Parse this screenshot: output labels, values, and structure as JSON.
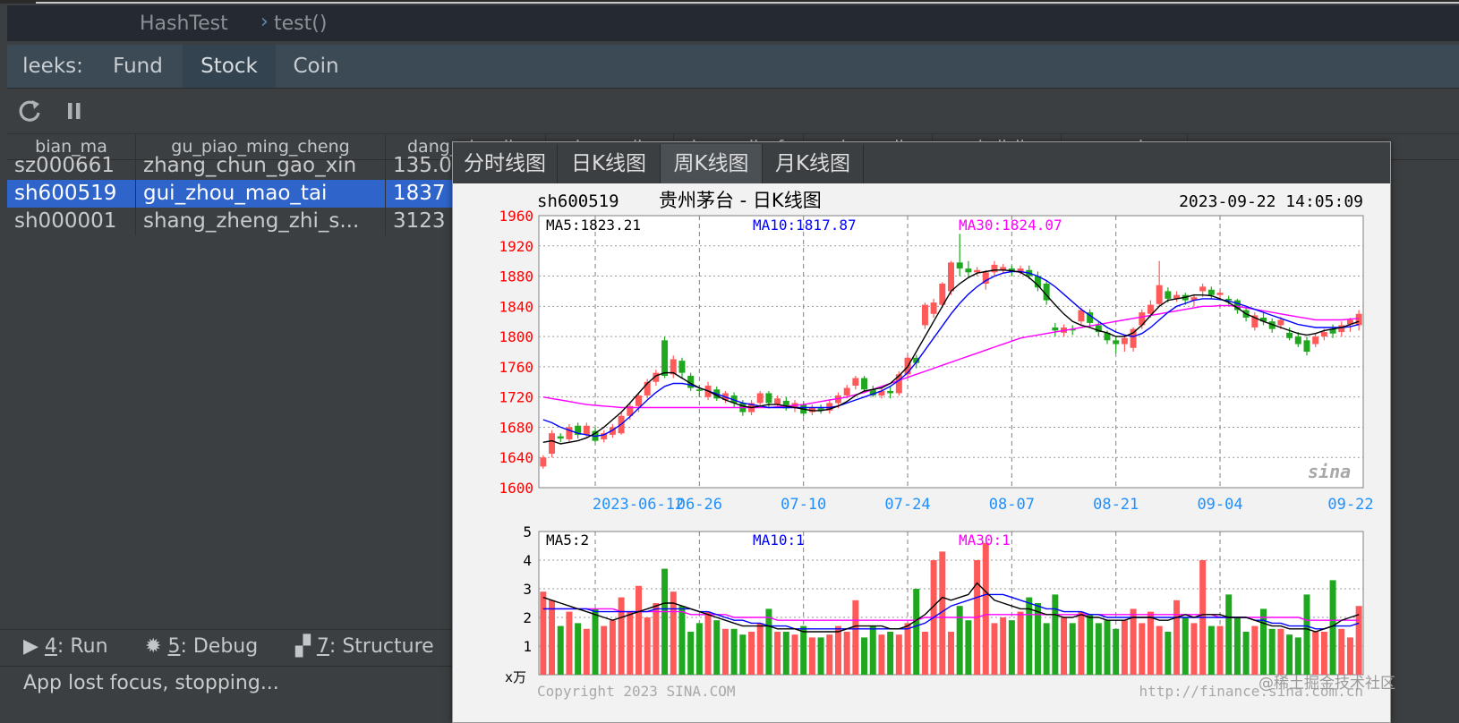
{
  "breadcrumb": {
    "class_name": "HashTest",
    "method_name": "test()"
  },
  "tabs": {
    "prefix": "leeks:",
    "items": [
      "Fund",
      "Stock",
      "Coin"
    ],
    "active": "Stock"
  },
  "toolbar": {
    "refresh_icon": "refresh-icon",
    "pause_icon": "pause-icon"
  },
  "table": {
    "columns": [
      "bian_ma",
      "gu_piao_ming_cheng",
      "dang_qian_jia",
      "zhang_die",
      "zhang_die_fu",
      "zui_gao_jia",
      "zui_di_jia",
      "geng_xin_s"
    ],
    "rows": [
      {
        "code": "sz000661",
        "name": "zhang_chun_gao_xin",
        "price": "135.0"
      },
      {
        "code": "sh600519",
        "name": "gui_zhou_mao_tai",
        "price": "1837"
      },
      {
        "code": "sh000001",
        "name": "shang_zheng_zhi_s...",
        "price": "3123"
      }
    ],
    "selected_row": 1
  },
  "popup": {
    "tabs": [
      "分时线图",
      "日K线图",
      "周K线图",
      "月K线图"
    ],
    "active_tab": "日K线图"
  },
  "chart_header": {
    "symbol": "sh600519",
    "title": "贵州茅台 - 日K线图",
    "timestamp": "2023-09-22 14:05:09"
  },
  "chart_data": [
    {
      "type": "candlestick",
      "ylim": [
        1600,
        1960
      ],
      "yticks": [
        1600,
        1640,
        1680,
        1720,
        1760,
        1800,
        1840,
        1880,
        1920,
        1960
      ],
      "xticks": [
        "2023-06-12",
        "06-26",
        "07-10",
        "07-24",
        "08-07",
        "08-21",
        "09-04",
        "09-22"
      ],
      "legend": {
        "ma5": "MA5:1823.21",
        "ma10": "MA10:1817.87",
        "ma30": "MA30:1824.07"
      },
      "colors": {
        "up": "#ff5a5a",
        "down": "#1fa81f",
        "ma5": "#000000",
        "ma10": "#0000ff",
        "ma30": "#ff00ff",
        "axis_text": "#ff0000",
        "date_text": "#1e90ff"
      },
      "candles": [
        [
          1628,
          1640,
          1625,
          1643
        ],
        [
          1645,
          1672,
          1640,
          1676
        ],
        [
          1668,
          1665,
          1660,
          1672
        ],
        [
          1664,
          1680,
          1660,
          1684
        ],
        [
          1682,
          1670,
          1665,
          1686
        ],
        [
          1670,
          1682,
          1668,
          1686
        ],
        [
          1675,
          1662,
          1660,
          1680
        ],
        [
          1664,
          1672,
          1660,
          1676
        ],
        [
          1670,
          1680,
          1666,
          1684
        ],
        [
          1672,
          1695,
          1670,
          1700
        ],
        [
          1695,
          1708,
          1690,
          1712
        ],
        [
          1708,
          1722,
          1700,
          1726
        ],
        [
          1722,
          1740,
          1718,
          1744
        ],
        [
          1740,
          1752,
          1735,
          1756
        ],
        [
          1795,
          1748,
          1745,
          1800
        ],
        [
          1750,
          1770,
          1745,
          1775
        ],
        [
          1768,
          1752,
          1745,
          1772
        ],
        [
          1748,
          1732,
          1728,
          1752
        ],
        [
          1730,
          1728,
          1720,
          1736
        ],
        [
          1720,
          1735,
          1716,
          1740
        ],
        [
          1730,
          1718,
          1715,
          1734
        ],
        [
          1716,
          1725,
          1712,
          1728
        ],
        [
          1722,
          1712,
          1706,
          1726
        ],
        [
          1712,
          1700,
          1695,
          1716
        ],
        [
          1700,
          1712,
          1696,
          1716
        ],
        [
          1712,
          1725,
          1708,
          1728
        ],
        [
          1725,
          1712,
          1705,
          1728
        ],
        [
          1710,
          1718,
          1706,
          1722
        ],
        [
          1715,
          1705,
          1702,
          1720
        ],
        [
          1706,
          1712,
          1700,
          1716
        ],
        [
          1710,
          1698,
          1694,
          1714
        ],
        [
          1700,
          1706,
          1696,
          1710
        ],
        [
          1705,
          1702,
          1698,
          1710
        ],
        [
          1702,
          1712,
          1698,
          1716
        ],
        [
          1712,
          1722,
          1705,
          1726
        ],
        [
          1722,
          1732,
          1718,
          1736
        ],
        [
          1735,
          1745,
          1730,
          1748
        ],
        [
          1745,
          1730,
          1725,
          1748
        ],
        [
          1730,
          1722,
          1720,
          1735
        ],
        [
          1722,
          1728,
          1718,
          1732
        ],
        [
          1728,
          1725,
          1718,
          1734
        ],
        [
          1725,
          1750,
          1722,
          1754
        ],
        [
          1750,
          1772,
          1745,
          1775
        ],
        [
          1772,
          1765,
          1758,
          1776
        ],
        [
          1815,
          1842,
          1810,
          1845
        ],
        [
          1830,
          1845,
          1825,
          1850
        ],
        [
          1842,
          1870,
          1838,
          1872
        ],
        [
          1860,
          1898,
          1855,
          1900
        ],
        [
          1898,
          1890,
          1880,
          1936
        ],
        [
          1890,
          1885,
          1878,
          1900
        ],
        [
          1885,
          1888,
          1880,
          1892
        ],
        [
          1870,
          1885,
          1862,
          1888
        ],
        [
          1885,
          1895,
          1880,
          1900
        ],
        [
          1888,
          1892,
          1884,
          1896
        ],
        [
          1890,
          1886,
          1880,
          1894
        ],
        [
          1886,
          1890,
          1882,
          1894
        ],
        [
          1888,
          1880,
          1876,
          1894
        ],
        [
          1880,
          1865,
          1860,
          1886
        ],
        [
          1870,
          1848,
          1842,
          1874
        ],
        [
          1812,
          1808,
          1800,
          1818
        ],
        [
          1805,
          1812,
          1800,
          1816
        ],
        [
          1810,
          1808,
          1802,
          1815
        ],
        [
          1820,
          1835,
          1815,
          1838
        ],
        [
          1832,
          1818,
          1812,
          1836
        ],
        [
          1815,
          1806,
          1800,
          1820
        ],
        [
          1805,
          1795,
          1790,
          1808
        ],
        [
          1795,
          1790,
          1778,
          1800
        ],
        [
          1790,
          1798,
          1780,
          1802
        ],
        [
          1785,
          1810,
          1780,
          1812
        ],
        [
          1815,
          1832,
          1810,
          1836
        ],
        [
          1830,
          1842,
          1825,
          1848
        ],
        [
          1843,
          1868,
          1840,
          1900
        ],
        [
          1860,
          1850,
          1845,
          1865
        ],
        [
          1850,
          1855,
          1846,
          1860
        ],
        [
          1855,
          1848,
          1842,
          1858
        ],
        [
          1848,
          1852,
          1840,
          1856
        ],
        [
          1860,
          1866,
          1852,
          1870
        ],
        [
          1862,
          1855,
          1850,
          1866
        ],
        [
          1855,
          1858,
          1850,
          1862
        ],
        [
          1850,
          1848,
          1842,
          1854
        ],
        [
          1848,
          1835,
          1830,
          1850
        ],
        [
          1835,
          1825,
          1820,
          1840
        ],
        [
          1812,
          1828,
          1808,
          1832
        ],
        [
          1825,
          1820,
          1815,
          1832
        ],
        [
          1820,
          1810,
          1805,
          1824
        ],
        [
          1815,
          1822,
          1810,
          1826
        ],
        [
          1805,
          1798,
          1795,
          1812
        ],
        [
          1800,
          1790,
          1786,
          1806
        ],
        [
          1795,
          1780,
          1775,
          1800
        ],
        [
          1790,
          1800,
          1786,
          1804
        ],
        [
          1800,
          1806,
          1795,
          1810
        ],
        [
          1810,
          1804,
          1798,
          1816
        ],
        [
          1806,
          1815,
          1800,
          1820
        ],
        [
          1816,
          1822,
          1806,
          1825
        ],
        [
          1815,
          1830,
          1808,
          1835
        ]
      ],
      "ma5": [
        1660,
        1662,
        1658,
        1660,
        1662,
        1666,
        1672,
        1680,
        1690,
        1700,
        1712,
        1725,
        1738,
        1748,
        1752,
        1752,
        1745,
        1738,
        1732,
        1728,
        1722,
        1716,
        1712,
        1708,
        1706,
        1708,
        1710,
        1710,
        1708,
        1706,
        1704,
        1702,
        1702,
        1704,
        1708,
        1714,
        1722,
        1728,
        1730,
        1732,
        1738,
        1748,
        1760,
        1780,
        1800,
        1820,
        1840,
        1860,
        1870,
        1878,
        1884,
        1886,
        1888,
        1888,
        1887,
        1885,
        1878,
        1868,
        1855,
        1842,
        1830,
        1820,
        1815,
        1812,
        1808,
        1805,
        1800,
        1800,
        1805,
        1815,
        1828,
        1840,
        1848,
        1850,
        1852,
        1855,
        1855,
        1854,
        1850,
        1845,
        1838,
        1830,
        1825,
        1820,
        1816,
        1812,
        1808,
        1804,
        1802,
        1804,
        1808,
        1810,
        1812,
        1816,
        1820
      ],
      "ma10": [
        1690,
        1686,
        1680,
        1676,
        1672,
        1670,
        1668,
        1670,
        1676,
        1684,
        1694,
        1705,
        1716,
        1726,
        1734,
        1738,
        1738,
        1736,
        1732,
        1728,
        1724,
        1720,
        1716,
        1712,
        1710,
        1708,
        1706,
        1706,
        1706,
        1706,
        1706,
        1706,
        1706,
        1706,
        1708,
        1712,
        1716,
        1720,
        1724,
        1728,
        1734,
        1742,
        1752,
        1766,
        1782,
        1798,
        1814,
        1830,
        1844,
        1856,
        1866,
        1874,
        1880,
        1884,
        1886,
        1886,
        1884,
        1880,
        1874,
        1866,
        1856,
        1846,
        1836,
        1828,
        1820,
        1812,
        1806,
        1802,
        1800,
        1804,
        1812,
        1822,
        1832,
        1840,
        1844,
        1848,
        1850,
        1850,
        1849,
        1847,
        1844,
        1840,
        1836,
        1832,
        1828,
        1824,
        1820,
        1816,
        1814,
        1812,
        1812,
        1812,
        1812,
        1813,
        1816
      ],
      "ma30": [
        1720,
        1718,
        1716,
        1714,
        1712,
        1710,
        1709,
        1708,
        1707,
        1706,
        1706,
        1706,
        1706,
        1706,
        1706,
        1706,
        1706,
        1706,
        1706,
        1706,
        1706,
        1706,
        1706,
        1706,
        1706,
        1706,
        1706,
        1707,
        1708,
        1709,
        1710,
        1712,
        1714,
        1716,
        1718,
        1720,
        1723,
        1726,
        1730,
        1734,
        1738,
        1742,
        1746,
        1750,
        1754,
        1758,
        1762,
        1766,
        1770,
        1774,
        1778,
        1782,
        1786,
        1790,
        1794,
        1798,
        1800,
        1802,
        1804,
        1806,
        1808,
        1810,
        1812,
        1814,
        1816,
        1818,
        1820,
        1822,
        1824,
        1826,
        1828,
        1830,
        1832,
        1834,
        1836,
        1838,
        1840,
        1840,
        1841,
        1841,
        1840,
        1838,
        1836,
        1834,
        1832,
        1830,
        1828,
        1826,
        1824,
        1822,
        1822,
        1822,
        1822,
        1823,
        1824
      ]
    },
    {
      "type": "bar",
      "ylim": [
        0,
        5
      ],
      "yticks": [
        1,
        2,
        3,
        4,
        5
      ],
      "unit_label": "x万",
      "legend": {
        "ma5": "MA5:2",
        "ma10": "MA10:1",
        "ma30": "MA30:1"
      },
      "volumes": [
        2.9,
        2.6,
        1.7,
        2.2,
        1.8,
        1.6,
        2.3,
        1.7,
        1.9,
        2.7,
        2.2,
        3.1,
        2.0,
        2.5,
        3.7,
        2.9,
        2.4,
        1.5,
        1.8,
        2.2,
        1.9,
        1.6,
        1.6,
        1.4,
        1.5,
        1.8,
        2.3,
        1.5,
        1.5,
        1.4,
        1.7,
        1.3,
        1.3,
        1.4,
        1.7,
        1.5,
        2.6,
        1.3,
        1.7,
        1.4,
        1.5,
        1.4,
        1.8,
        3.0,
        1.5,
        4.0,
        4.3,
        1.5,
        2.4,
        1.9,
        4.0,
        4.6,
        1.8,
        2.0,
        1.9,
        2.2,
        2.7,
        2.5,
        1.8,
        2.8,
        2.0,
        1.8,
        2.2,
        2.1,
        1.8,
        1.9,
        1.6,
        1.9,
        2.3,
        1.8,
        2.2,
        1.7,
        1.5,
        2.6,
        2.0,
        1.8,
        4.0,
        1.7,
        1.7,
        2.8,
        2.0,
        1.5,
        1.7,
        2.3,
        1.6,
        1.6,
        1.4,
        1.3,
        2.8,
        1.5,
        1.5,
        3.3,
        1.6,
        1.3,
        2.4
      ],
      "vol_ma5": [
        2.7,
        2.6,
        2.5,
        2.4,
        2.3,
        2.2,
        2.1,
        2.0,
        1.9,
        2.0,
        2.1,
        2.2,
        2.3,
        2.4,
        2.5,
        2.5,
        2.4,
        2.3,
        2.2,
        2.1,
        2.0,
        1.9,
        1.8,
        1.7,
        1.7,
        1.7,
        1.7,
        1.6,
        1.6,
        1.6,
        1.5,
        1.5,
        1.5,
        1.5,
        1.5,
        1.6,
        1.7,
        1.7,
        1.7,
        1.7,
        1.6,
        1.6,
        1.7,
        1.9,
        2.1,
        2.4,
        2.7,
        2.6,
        2.7,
        2.8,
        3.2,
        2.9,
        2.6,
        2.5,
        2.4,
        2.3,
        2.3,
        2.2,
        2.1,
        2.1,
        2.0,
        2.0,
        2.1,
        2.0,
        2.0,
        1.9,
        1.9,
        1.9,
        2.0,
        2.0,
        2.0,
        1.9,
        1.9,
        2.0,
        2.1,
        2.0,
        2.1,
        2.1,
        2.1,
        2.0,
        2.0,
        2.0,
        1.9,
        1.8,
        1.7,
        1.7,
        1.6,
        1.6,
        1.6,
        1.5,
        1.6,
        1.7,
        1.9,
        2.0,
        2.1
      ],
      "vol_ma10": [
        2.3,
        2.3,
        2.3,
        2.3,
        2.3,
        2.3,
        2.2,
        2.2,
        2.2,
        2.2,
        2.2,
        2.2,
        2.2,
        2.3,
        2.3,
        2.3,
        2.3,
        2.3,
        2.2,
        2.2,
        2.1,
        2.0,
        1.9,
        1.9,
        1.8,
        1.8,
        1.7,
        1.7,
        1.7,
        1.6,
        1.6,
        1.6,
        1.6,
        1.6,
        1.6,
        1.6,
        1.6,
        1.6,
        1.6,
        1.6,
        1.6,
        1.6,
        1.6,
        1.7,
        1.8,
        2.0,
        2.2,
        2.4,
        2.5,
        2.6,
        2.7,
        2.8,
        2.8,
        2.8,
        2.7,
        2.6,
        2.5,
        2.4,
        2.3,
        2.3,
        2.2,
        2.2,
        2.2,
        2.1,
        2.1,
        2.0,
        2.0,
        2.0,
        2.0,
        2.0,
        2.0,
        2.0,
        2.0,
        2.0,
        2.0,
        2.0,
        2.0,
        2.0,
        2.0,
        2.0,
        2.0,
        2.0,
        1.9,
        1.9,
        1.8,
        1.8,
        1.7,
        1.7,
        1.7,
        1.6,
        1.6,
        1.7,
        1.7,
        1.7,
        1.8
      ],
      "vol_ma30": [
        2.3,
        2.3,
        2.3,
        2.3,
        2.3,
        2.3,
        2.3,
        2.3,
        2.3,
        2.2,
        2.2,
        2.2,
        2.2,
        2.2,
        2.2,
        2.2,
        2.2,
        2.1,
        2.1,
        2.1,
        2.1,
        2.1,
        2.0,
        2.0,
        2.0,
        2.0,
        2.0,
        1.9,
        1.9,
        1.9,
        1.9,
        1.9,
        1.9,
        1.9,
        1.9,
        1.9,
        1.9,
        1.9,
        1.9,
        1.9,
        1.9,
        1.9,
        1.9,
        1.9,
        2.0,
        2.0,
        2.0,
        2.0,
        2.0,
        2.0,
        2.0,
        2.1,
        2.1,
        2.1,
        2.1,
        2.1,
        2.1,
        2.1,
        2.1,
        2.1,
        2.1,
        2.1,
        2.1,
        2.1,
        2.1,
        2.1,
        2.1,
        2.1,
        2.1,
        2.1,
        2.1,
        2.1,
        2.1,
        2.1,
        2.1,
        2.1,
        2.1,
        2.1,
        2.0,
        2.0,
        2.0,
        2.0,
        2.0,
        2.0,
        2.0,
        2.0,
        2.0,
        2.0,
        1.9,
        1.9,
        1.9,
        1.9,
        1.9,
        1.9,
        1.9
      ]
    }
  ],
  "footer": {
    "copyright": "Copyright 2023 SINA.COM",
    "url": "http://finance.sina.com.cn",
    "logo_text": "sina"
  },
  "bottom_tools": [
    {
      "key": "4",
      "label": ": Run"
    },
    {
      "key": "5",
      "label": ": Debug"
    },
    {
      "key": "7",
      "label": ": Structure"
    }
  ],
  "status": "App lost focus, stopping...",
  "watermark": "@稀土掘金技术社区"
}
